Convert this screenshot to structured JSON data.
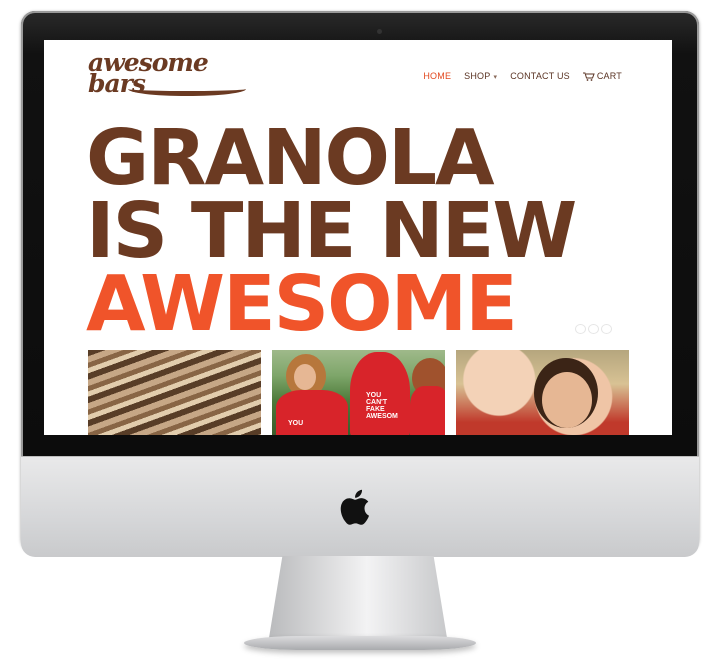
{
  "site": {
    "logo_line1": "awesome",
    "logo_line2": "bars"
  },
  "nav": {
    "items": [
      {
        "label": "HOME",
        "active": true
      },
      {
        "label": "SHOP",
        "has_dropdown": true
      },
      {
        "label": "CONTACT US"
      },
      {
        "label": "CART",
        "icon": "cart-icon"
      }
    ]
  },
  "hero": {
    "line1": "GRANOLA",
    "line2": "IS THE NEW",
    "line3": "AWESOME"
  },
  "photos": [
    {
      "name": "granola-bar-photo",
      "caption": ""
    },
    {
      "name": "red-hoodie-group-photo",
      "hoodie_text_1": "YOU",
      "hoodie_text_2": "YOU CAN'T FAKE AWESOM"
    },
    {
      "name": "smiling-people-photo",
      "caption": ""
    }
  ],
  "colors": {
    "brand_brown": "#6b3a22",
    "accent_orange": "#f0542a",
    "active_nav": "#e2481f"
  }
}
